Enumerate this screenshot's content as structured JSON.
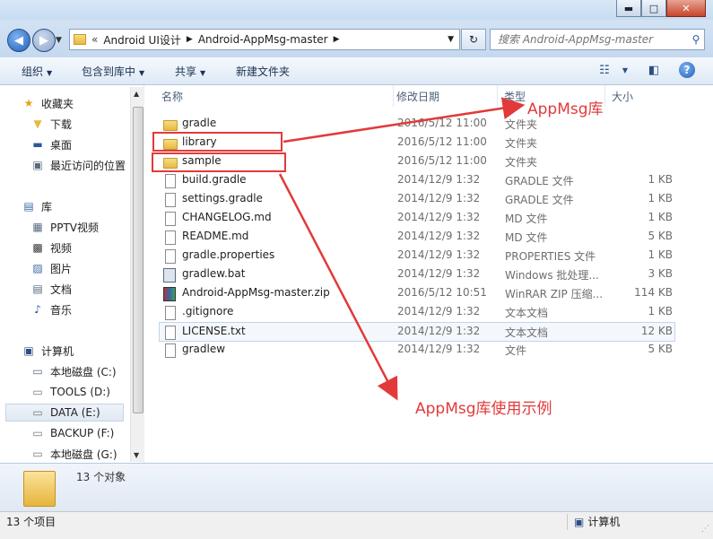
{
  "window": {
    "minimize_glyph": "▬",
    "maximize_glyph": "□",
    "close_glyph": "✕"
  },
  "address": {
    "chevron": "«",
    "crumbs": [
      "Android UI设计",
      "Android-AppMsg-master"
    ],
    "search_placeholder": "搜索 Android-AppMsg-master"
  },
  "toolbar": {
    "organize": "组织",
    "include_library": "包含到库中",
    "share": "共享",
    "new_folder": "新建文件夹"
  },
  "nav": {
    "favorites": "收藏夹",
    "fav_items": [
      "下载",
      "桌面",
      "最近访问的位置"
    ],
    "libraries": "库",
    "lib_items": [
      "PPTV视频",
      "视频",
      "图片",
      "文档",
      "音乐"
    ],
    "computer": "计算机",
    "drives": [
      "本地磁盘 (C:)",
      "TOOLS (D:)",
      "DATA (E:)",
      "BACKUP (F:)",
      "本地磁盘 (G:)"
    ]
  },
  "columns": {
    "name": "名称",
    "date": "修改日期",
    "type": "类型",
    "size": "大小"
  },
  "files": [
    {
      "name": "gradle",
      "date": "2016/5/12 11:00",
      "type": "文件夹",
      "size": "",
      "icon": "folder-icon"
    },
    {
      "name": "library",
      "date": "2016/5/12 11:00",
      "type": "文件夹",
      "size": "",
      "icon": "folder-icon"
    },
    {
      "name": "sample",
      "date": "2016/5/12 11:00",
      "type": "文件夹",
      "size": "",
      "icon": "folder-icon"
    },
    {
      "name": "build.gradle",
      "date": "2014/12/9 1:32",
      "type": "GRADLE 文件",
      "size": "1 KB",
      "icon": "file-icon"
    },
    {
      "name": "settings.gradle",
      "date": "2014/12/9 1:32",
      "type": "GRADLE 文件",
      "size": "1 KB",
      "icon": "file-icon"
    },
    {
      "name": "CHANGELOG.md",
      "date": "2014/12/9 1:32",
      "type": "MD 文件",
      "size": "1 KB",
      "icon": "file-icon"
    },
    {
      "name": "README.md",
      "date": "2014/12/9 1:32",
      "type": "MD 文件",
      "size": "5 KB",
      "icon": "file-icon"
    },
    {
      "name": "gradle.properties",
      "date": "2014/12/9 1:32",
      "type": "PROPERTIES 文件",
      "size": "1 KB",
      "icon": "file-icon"
    },
    {
      "name": "gradlew.bat",
      "date": "2014/12/9 1:32",
      "type": "Windows 批处理...",
      "size": "3 KB",
      "icon": "batch-file-icon"
    },
    {
      "name": "Android-AppMsg-master.zip",
      "date": "2016/5/12 10:51",
      "type": "WinRAR ZIP 压缩...",
      "size": "114 KB",
      "icon": "zip-archive-icon"
    },
    {
      "name": ".gitignore",
      "date": "2014/12/9 1:32",
      "type": "文本文档",
      "size": "1 KB",
      "icon": "file-icon"
    },
    {
      "name": "LICENSE.txt",
      "date": "2014/12/9 1:32",
      "type": "文本文档",
      "size": "12 KB",
      "icon": "text-file-icon"
    },
    {
      "name": "gradlew",
      "date": "2014/12/9 1:32",
      "type": "文件",
      "size": "5 KB",
      "icon": "file-icon"
    }
  ],
  "details": {
    "count": "13 个对象"
  },
  "status": {
    "items": "13 个项目",
    "location": "计算机"
  },
  "annotations": {
    "library_label": "AppMsg库",
    "sample_label": "AppMsg库使用示例"
  },
  "colors": {
    "annotation": "#e23a3a",
    "folder": "#e8b93f",
    "chrome": "#c4d8ef"
  }
}
